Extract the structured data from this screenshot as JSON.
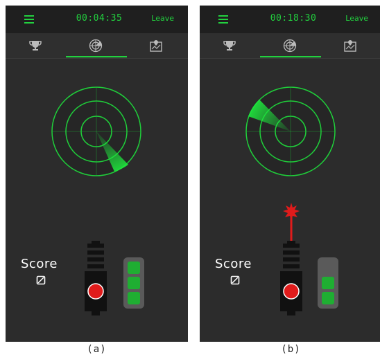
{
  "panels": [
    {
      "id": "a",
      "caption": "(a)",
      "header": {
        "timer": "00:04:35",
        "leave_label": "Leave"
      },
      "tabs": [
        {
          "name": "leaderboard",
          "icon": "trophy-icon"
        },
        {
          "name": "radar",
          "icon": "radar-icon",
          "active": true
        },
        {
          "name": "map",
          "icon": "map-icon"
        }
      ],
      "radar": {
        "rings": 3,
        "sweep": "lower-right"
      },
      "score": {
        "label": "Score",
        "value": "0"
      },
      "gun": {
        "fired": false
      },
      "ammo": {
        "cells_filled": 3
      }
    },
    {
      "id": "b",
      "caption": "(b)",
      "header": {
        "timer": "00:18:30",
        "leave_label": "Leave"
      },
      "tabs": [
        {
          "name": "leaderboard",
          "icon": "trophy-icon"
        },
        {
          "name": "radar",
          "icon": "radar-icon",
          "active": true
        },
        {
          "name": "map",
          "icon": "map-icon"
        }
      ],
      "radar": {
        "rings": 3,
        "sweep": "upper-left"
      },
      "score": {
        "label": "Score",
        "value": "0"
      },
      "gun": {
        "fired": true
      },
      "ammo": {
        "cells_filled": 2
      }
    }
  ],
  "colors": {
    "accent": "#22d13f",
    "background": "#2c2c2c",
    "header": "#1f1f1f",
    "laser": "#e01b1b",
    "fire_button": "#e01b1b"
  }
}
